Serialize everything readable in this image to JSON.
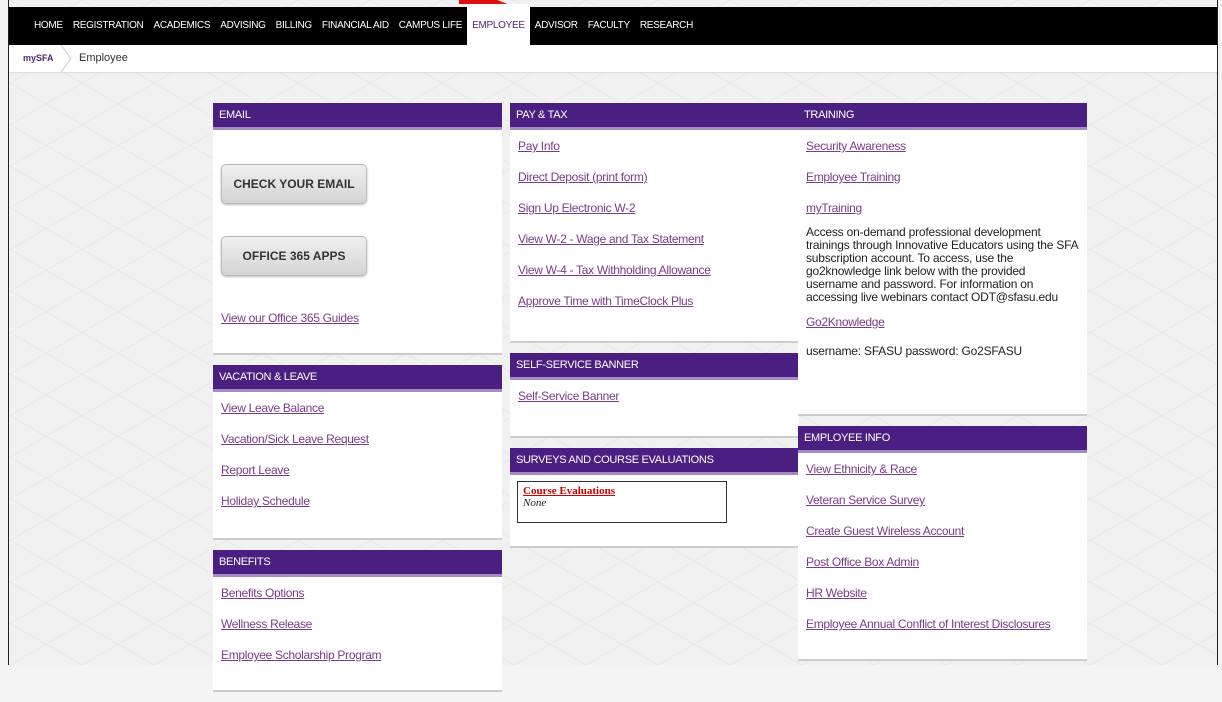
{
  "topnav": {
    "items": [
      {
        "label": "HOME"
      },
      {
        "label": "REGISTRATION"
      },
      {
        "label": "ACADEMICS"
      },
      {
        "label": "ADVISING"
      },
      {
        "label": "BILLING"
      },
      {
        "label": "FINANCIAL AID"
      },
      {
        "label": "CAMPUS LIFE"
      },
      {
        "label": "EMPLOYEE"
      },
      {
        "label": "ADVISOR"
      },
      {
        "label": "FACULTY"
      },
      {
        "label": "RESEARCH"
      }
    ]
  },
  "breadcrumb": {
    "home": "mySFA",
    "current": "Employee"
  },
  "email": {
    "title": "EMAIL",
    "check_button": "CHECK YOUR EMAIL",
    "office_button": "OFFICE 365 APPS",
    "guides_link": "View our Office 365 Guides"
  },
  "vacation": {
    "title": "VACATION & LEAVE",
    "links": [
      "View Leave Balance",
      "Vacation/Sick Leave Request",
      "Report Leave",
      "Holiday Schedule"
    ]
  },
  "benefits": {
    "title": "BENEFITS",
    "links": [
      "Benefits Options",
      "Wellness Release",
      "Employee Scholarship Program"
    ]
  },
  "paytax": {
    "title": "PAY & TAX",
    "links": [
      "Pay Info",
      "Direct Deposit (print form)",
      "Sign Up Electronic W-2",
      "View W-2 - Wage and Tax Statement",
      "View W-4 - Tax Withholding Allowance",
      "Approve Time with TimeClock Plus"
    ]
  },
  "banner": {
    "title": "SELF-SERVICE BANNER",
    "link": "Self-Service Banner"
  },
  "surveys": {
    "title": "SURVEYS AND COURSE EVALUATIONS",
    "eval_title": "Course Evaluations",
    "eval_value": "None"
  },
  "training": {
    "title": "TRAINING",
    "links": [
      "Security Awareness",
      "Employee Training",
      "myTraining"
    ],
    "description": "Access on-demand professional development trainings through Innovative Educators using the SFA subscription account. To access, use the go2knowledge link below with the provided username and password. For information on accessing live webinars contact ODT@sfasu.edu",
    "go2_link": "Go2Knowledge",
    "credentials": "username: SFASU password: Go2SFASU"
  },
  "employeeinfo": {
    "title": "EMPLOYEE INFO",
    "links": [
      "View Ethnicity & Race",
      "Veteran Service Survey",
      "Create Guest Wireless Account",
      "Post Office Box Admin",
      "HR Website",
      "Employee Annual Conflict of Interest Disclosures"
    ]
  },
  "colors": {
    "nav_bg": "#000000",
    "panel_header": "#4b1f82",
    "link": "#7c3a8a",
    "arrow": "#e01010"
  }
}
